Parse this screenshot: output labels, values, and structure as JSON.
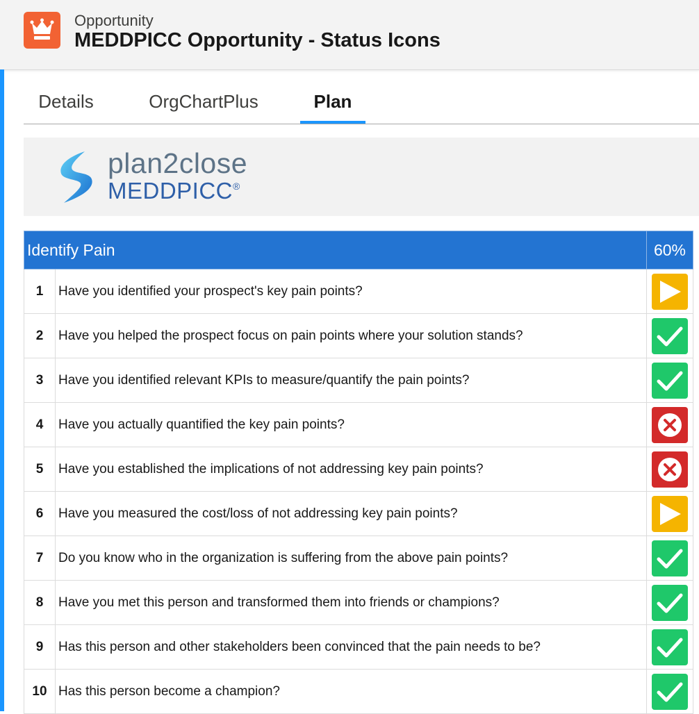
{
  "header": {
    "object_label": "Opportunity",
    "record_title": "MEDDPICC Opportunity - Status Icons",
    "app_icon": "crown-icon",
    "accent_color": "#f26233"
  },
  "tabs": [
    {
      "label": "Details"
    },
    {
      "label": "OrgChartPlus"
    },
    {
      "label": "Plan",
      "active": true
    }
  ],
  "banner": {
    "logo_main": "plan2close",
    "logo_sub": "MEDDPICC",
    "logo_reg": "®"
  },
  "section": {
    "title": "Identify Pain",
    "percent": "60%",
    "header_color": "#2374d2"
  },
  "status_colors": {
    "in_progress": "#f5b400",
    "complete": "#1fc86a",
    "failed": "#d32a2a"
  },
  "rows": [
    {
      "num": "1",
      "question": "Have you identified your prospect's key pain points?",
      "status": "in-progress"
    },
    {
      "num": "2",
      "question": "Have you helped the prospect focus on pain points where your solution stands?",
      "status": "complete"
    },
    {
      "num": "3",
      "question": "Have you identified relevant KPIs to measure/quantify the pain points?",
      "status": "complete"
    },
    {
      "num": "4",
      "question": "Have you actually quantified the key pain points?",
      "status": "failed"
    },
    {
      "num": "5",
      "question": "Have you established the implications of not addressing key pain points?",
      "status": "failed"
    },
    {
      "num": "6",
      "question": "Have you measured the cost/loss of not addressing key pain points?",
      "status": "in-progress"
    },
    {
      "num": "7",
      "question": "Do you know who in the organization is suffering from the above pain points?",
      "status": "complete"
    },
    {
      "num": "8",
      "question": "Have you met this person and transformed them into friends or champions?",
      "status": "complete"
    },
    {
      "num": "9",
      "question": "Has this person and other stakeholders been convinced that the pain needs to be?",
      "status": "complete"
    },
    {
      "num": "10",
      "question": "Has this person become a champion?",
      "status": "complete"
    }
  ]
}
